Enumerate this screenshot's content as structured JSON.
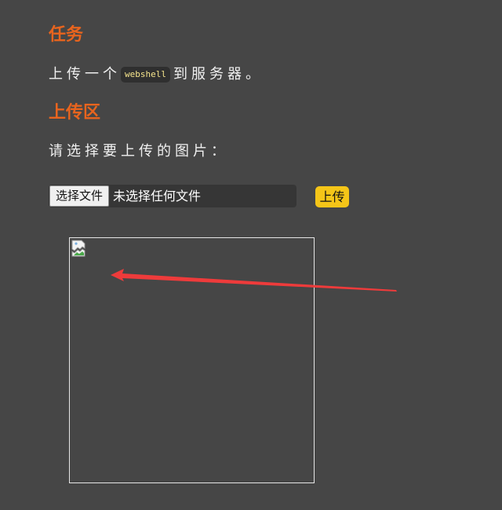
{
  "task": {
    "heading": "任务",
    "text_before": "上传一个",
    "code": "webshell",
    "text_after": "到服务器。"
  },
  "upload": {
    "heading": "上传区",
    "prompt": "请选择要上传的图片：",
    "choose_button_label": "选择文件",
    "file_status": "未选择任何文件",
    "submit_label": "上传"
  },
  "preview": {
    "image": "broken-image-icon"
  },
  "annotation": {
    "arrow_color": "#ee3b3b",
    "icon": "red-arrow"
  },
  "colors": {
    "background": "#464646",
    "heading": "#e8641e",
    "submit_button": "#f5c518",
    "code_text": "#f6e58d"
  }
}
